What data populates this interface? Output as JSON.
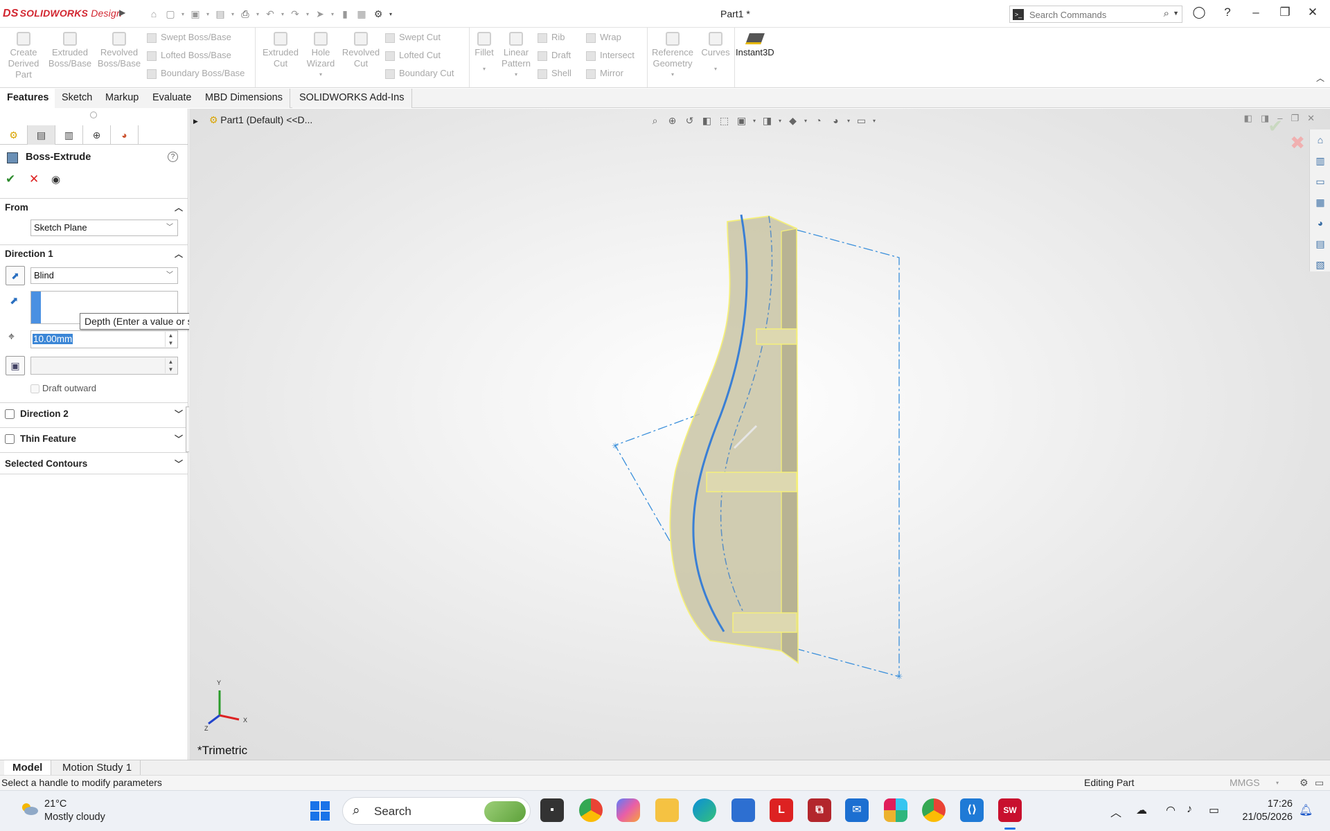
{
  "app": {
    "brand_prefix": "DS",
    "brand": "SOLIDWORKS",
    "brand_suffix": "Design",
    "doc_title": "Part1 *"
  },
  "search": {
    "placeholder": "Search Commands"
  },
  "ribbon": {
    "create_derived": "Create Derived Part",
    "extruded_boss": "Extruded Boss/Base",
    "revolved_boss": "Revolved Boss/Base",
    "swept_boss": "Swept Boss/Base",
    "lofted_boss": "Lofted Boss/Base",
    "boundary_boss": "Boundary Boss/Base",
    "extruded_cut": "Extruded Cut",
    "hole_wizard": "Hole Wizard",
    "revolved_cut": "Revolved Cut",
    "swept_cut": "Swept Cut",
    "lofted_cut": "Lofted Cut",
    "boundary_cut": "Boundary Cut",
    "fillet": "Fillet",
    "linear_pattern": "Linear Pattern",
    "rib": "Rib",
    "draft": "Draft",
    "shell": "Shell",
    "wrap": "Wrap",
    "intersect": "Intersect",
    "mirror": "Mirror",
    "reference_geometry": "Reference Geometry",
    "curves": "Curves",
    "instant3d": "Instant3D"
  },
  "cmd_tabs": [
    "Features",
    "Sketch",
    "Markup",
    "Evaluate",
    "MBD Dimensions",
    "SOLIDWORKS Add-Ins"
  ],
  "property_manager": {
    "title": "Boss-Extrude",
    "from": {
      "label": "From",
      "value": "Sketch Plane"
    },
    "direction1": {
      "label": "Direction 1",
      "end_condition": "Blind",
      "depth": "10.00mm",
      "draft_outward": "Draft outward"
    },
    "tooltip": "Depth (Enter a value or start with = to create an equation)",
    "direction2": {
      "label": "Direction 2"
    },
    "thin_feature": {
      "label": "Thin Feature"
    },
    "selected_contours": {
      "label": "Selected Contours"
    }
  },
  "viewport": {
    "breadcrumb": "Part1 (Default) <<D...",
    "view_name": "*Trimetric",
    "axis_x": "X",
    "axis_y": "Y",
    "axis_z": "Z"
  },
  "bottom_tabs": [
    "Model",
    "Motion Study 1"
  ],
  "status": {
    "message": "Select a handle to modify parameters",
    "mode": "Editing Part",
    "units": "MMGS"
  },
  "taskbar": {
    "weather_temp": "21°C",
    "weather_desc": "Mostly cloudy",
    "search_label": "Search",
    "time": "17:26",
    "date": "21/05/2026"
  }
}
